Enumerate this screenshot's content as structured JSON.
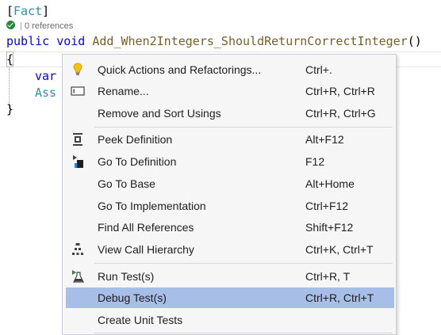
{
  "editor": {
    "attribute": {
      "open": "[",
      "name": "Fact",
      "close": "]"
    },
    "codelens": {
      "references": "0 references"
    },
    "method": {
      "modifier": "public",
      "return_type": "void",
      "name": "Add_When2Integers_ShouldReturnCorrectInteger",
      "parens": "()"
    },
    "open_brace": "{",
    "line_var_fragment": "var",
    "line_assert_fragment": "Ass",
    "close_brace": "}"
  },
  "context_menu": {
    "items": [
      {
        "label": "Quick Actions and Refactorings...",
        "shortcut": "Ctrl+.",
        "icon": "lightbulb-icon"
      },
      {
        "label": "Rename...",
        "shortcut": "Ctrl+R, Ctrl+R",
        "icon": "rename-icon"
      },
      {
        "label": "Remove and Sort Usings",
        "shortcut": "Ctrl+R, Ctrl+G",
        "icon": ""
      },
      {
        "label": "Peek Definition",
        "shortcut": "Alt+F12",
        "icon": "peek-definition-icon"
      },
      {
        "label": "Go To Definition",
        "shortcut": "F12",
        "icon": "go-to-definition-icon"
      },
      {
        "label": "Go To Base",
        "shortcut": "Alt+Home",
        "icon": ""
      },
      {
        "label": "Go To Implementation",
        "shortcut": "Ctrl+F12",
        "icon": ""
      },
      {
        "label": "Find All References",
        "shortcut": "Shift+F12",
        "icon": ""
      },
      {
        "label": "View Call Hierarchy",
        "shortcut": "Ctrl+K, Ctrl+T",
        "icon": "call-hierarchy-icon"
      },
      {
        "label": "Run Test(s)",
        "shortcut": "Ctrl+R, T",
        "icon": "run-test-icon"
      },
      {
        "label": "Debug Test(s)",
        "shortcut": "Ctrl+R, Ctrl+T",
        "icon": ""
      },
      {
        "label": "Create Unit Tests",
        "shortcut": "",
        "icon": ""
      }
    ],
    "highlighted_item": "Debug Test(s)"
  },
  "colors": {
    "keyword": "#0000ff",
    "method_name": "#795e26",
    "attribute": "#2b91af",
    "menu_background": "#f6f6f6",
    "menu_highlight": "#a7bee6"
  }
}
